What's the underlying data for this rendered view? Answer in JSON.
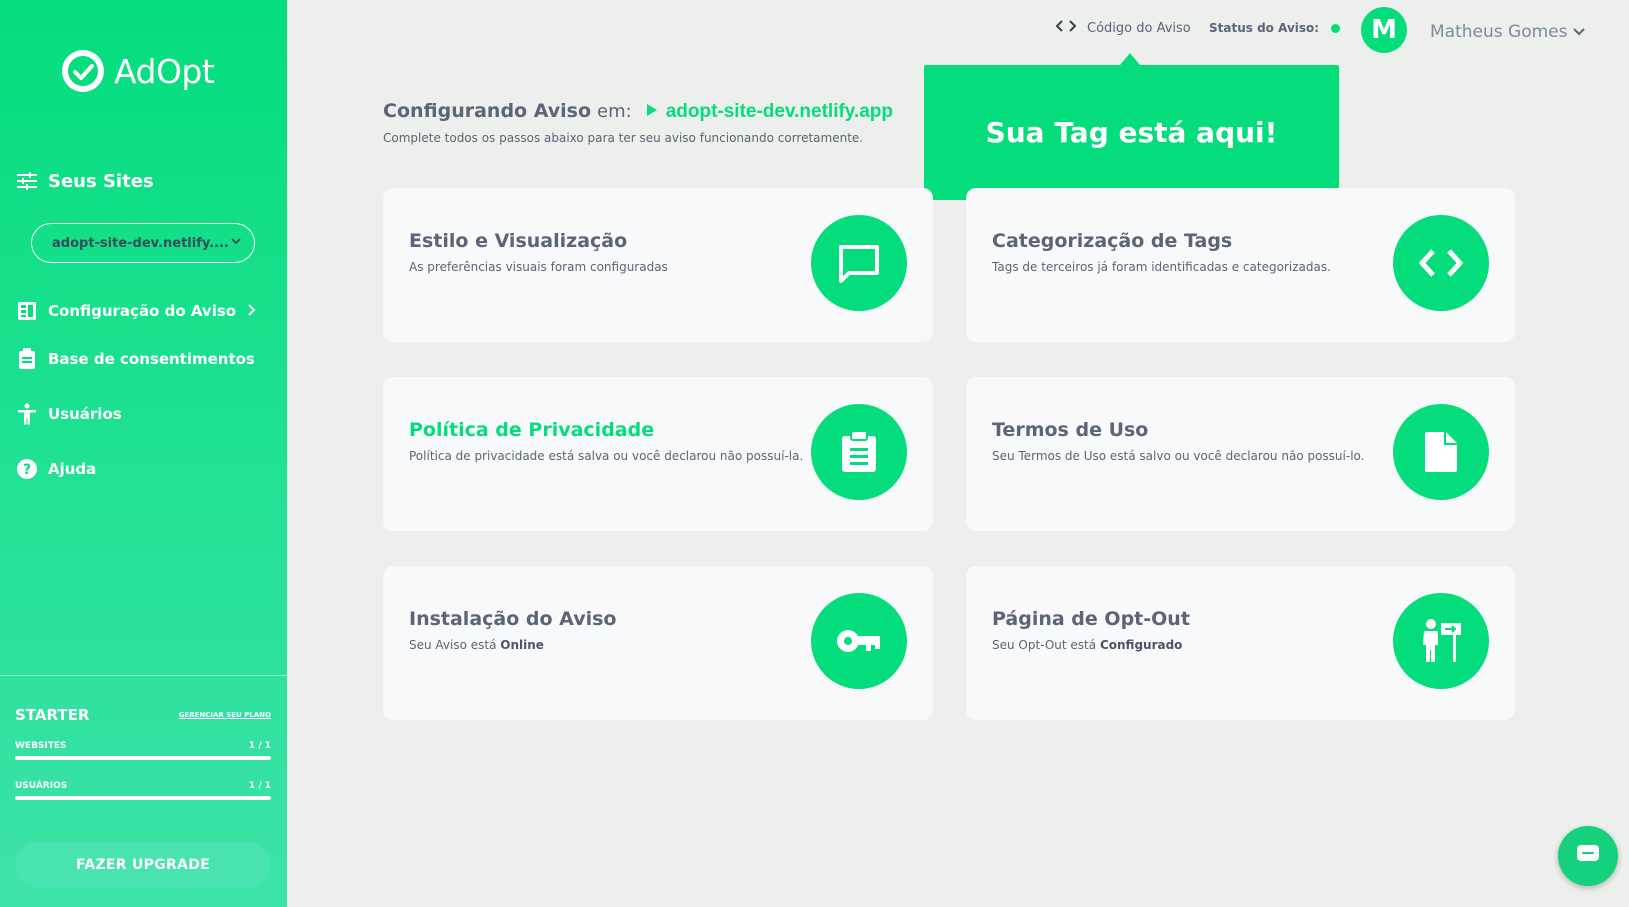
{
  "brand": {
    "name": "AdOpt"
  },
  "sidebar": {
    "sites_heading": "Seus Sites",
    "selected_site": "adopt-site-dev.netlify....",
    "nav": [
      {
        "label": "Configuração do Aviso",
        "icon": "dashboard-icon"
      },
      {
        "label": "Base de consentimentos",
        "icon": "clipboard-icon"
      },
      {
        "label": "Usuários",
        "icon": "accessibility-icon"
      },
      {
        "label": "Ajuda",
        "icon": "help-icon"
      }
    ],
    "plan": {
      "name": "STARTER",
      "manage_label": "GERENCIAR SEU PLANO",
      "websites_label": "WEBSITES",
      "websites_value": "1 / 1",
      "websites_fraction": 1.0,
      "users_label": "USUÁRIOS",
      "users_value": "1 / 1",
      "users_fraction": 1.0,
      "upgrade_label": "FAZER UPGRADE"
    }
  },
  "topbar": {
    "code_label": "Código do Aviso",
    "status_label": "Status do Aviso:",
    "avatar_initial": "M",
    "user_name": "Matheus Gomes"
  },
  "tooltip": {
    "text": "Sua Tag está aqui!"
  },
  "main": {
    "heading": "Configurando Aviso",
    "heading_em": "em:",
    "site": "adopt-site-dev.netlify.app",
    "subtitle": "Complete todos os passos abaixo para ter seu aviso funcionando corretamente.",
    "cards": [
      {
        "title": "Estilo e Visualização",
        "desc": "As preferências visuais foram configuradas",
        "icon": "chat-icon"
      },
      {
        "title": "Categorização de Tags",
        "desc": "Tags de terceiros já foram identificadas e categorizadas.",
        "icon": "code-icon"
      },
      {
        "title": "Política de Privacidade",
        "desc": "Política de privacidade está salva ou você declarou não possuí-la.",
        "icon": "clipboard-icon"
      },
      {
        "title": "Termos de Uso",
        "desc": "Seu Termos de Uso está salvo ou você declarou não possuí-lo.",
        "icon": "document-icon"
      },
      {
        "title": "Instalação do Aviso",
        "desc_prefix": "Seu Aviso está",
        "desc_strong": "Online",
        "icon": "key-icon"
      },
      {
        "title": "Página de Opt-Out",
        "desc_prefix": "Seu Opt-Out está",
        "desc_strong": "Configurado",
        "icon": "signpost-icon"
      }
    ]
  },
  "colors": {
    "accent": "#05dd7d",
    "text": "#5b6577",
    "background": "#ecefec"
  }
}
